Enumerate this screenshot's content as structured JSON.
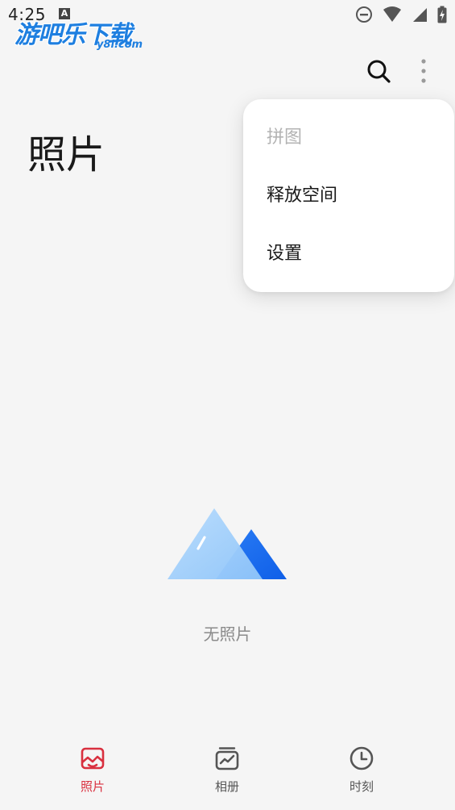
{
  "status_bar": {
    "time": "4:25",
    "notification_icon": "a-icon",
    "right_icons": [
      "do-not-disturb-icon",
      "wifi-icon",
      "signal-icon",
      "battery-charging-icon"
    ]
  },
  "watermark": {
    "cn_text": "游吧乐下载",
    "en_text": "y8l.com"
  },
  "toolbar": {
    "search_icon": "search-icon",
    "more_icon": "more-vert-icon"
  },
  "page": {
    "title": "照片"
  },
  "overflow_menu": {
    "items": [
      {
        "label": "拼图",
        "enabled": false
      },
      {
        "label": "释放空间",
        "enabled": true
      },
      {
        "label": "设置",
        "enabled": true
      }
    ]
  },
  "empty_state": {
    "icon": "mountain-icon",
    "text": "无照片"
  },
  "bottom_nav": {
    "items": [
      {
        "label": "照片",
        "icon": "photos-icon",
        "active": true
      },
      {
        "label": "相册",
        "icon": "albums-icon",
        "active": false
      },
      {
        "label": "时刻",
        "icon": "clock-icon",
        "active": false
      }
    ]
  },
  "colors": {
    "accent": "#d9303f",
    "background": "#f5f5f5",
    "menu_bg": "#ffffff",
    "disabled_text": "#b3b3b3",
    "illustration_light": "#a9d3fb",
    "illustration_dark": "#1467f0"
  }
}
